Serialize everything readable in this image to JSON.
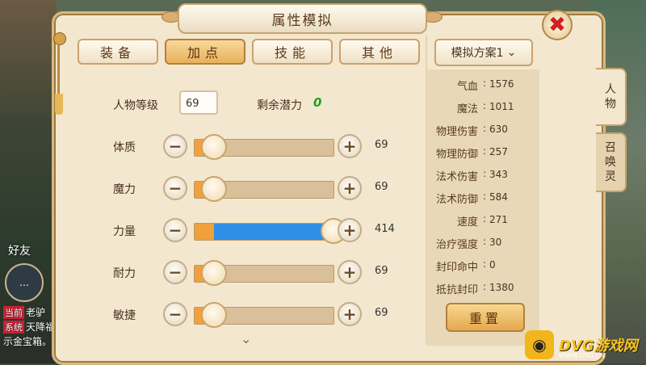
{
  "panel": {
    "title": "属性模拟",
    "close_glyph": "✖"
  },
  "tabs": [
    {
      "label": "装备",
      "active": false
    },
    {
      "label": "加点",
      "active": true
    },
    {
      "label": "技能",
      "active": false
    },
    {
      "label": "其他",
      "active": false
    }
  ],
  "level": {
    "label": "人物等级",
    "value": "69"
  },
  "potential": {
    "label": "剩余潜力",
    "value": "0"
  },
  "attributes": [
    {
      "label": "体质",
      "value": "69",
      "fill_fraction": 0.0
    },
    {
      "label": "魔力",
      "value": "69",
      "fill_fraction": 0.0
    },
    {
      "label": "力量",
      "value": "414",
      "fill_fraction": 1.0
    },
    {
      "label": "耐力",
      "value": "69",
      "fill_fraction": 0.0
    },
    {
      "label": "敏捷",
      "value": "69",
      "fill_fraction": 0.0
    }
  ],
  "controls": {
    "minus_glyph": "−",
    "plus_glyph": "+",
    "scroll_glyph": "⌄"
  },
  "scheme": {
    "label": "模拟方案1",
    "chevron": "⌄"
  },
  "stats": [
    {
      "name": "气血",
      "value": "1576"
    },
    {
      "name": "魔法",
      "value": "1011"
    },
    {
      "name": "物理伤害",
      "value": "630"
    },
    {
      "name": "物理防御",
      "value": "257"
    },
    {
      "name": "法术伤害",
      "value": "343"
    },
    {
      "name": "法术防御",
      "value": "584"
    },
    {
      "name": "速度",
      "value": "271"
    },
    {
      "name": "治疗强度",
      "value": "30"
    },
    {
      "name": "封印命中",
      "value": "0"
    },
    {
      "name": "抵抗封印",
      "value": "1380"
    }
  ],
  "reset_label": "重置",
  "side_tabs": [
    {
      "label": "人物",
      "active": true
    },
    {
      "label": "召唤灵",
      "active": false
    }
  ],
  "background": {
    "friends_label": "好友",
    "chat_lines": [
      {
        "tag": "当前",
        "text": "老驴"
      },
      {
        "tag": "系统",
        "text": "天降福"
      },
      {
        "tag": "",
        "text": "示金宝箱。"
      }
    ]
  },
  "watermark": {
    "text": "DVG游戏网",
    "sub": "WWW.DVG.CN"
  },
  "colors": {
    "panel_bg": "#f3e7cf",
    "accent_gold": "#e8b15c",
    "slider_blue": "#2f8ee6",
    "slider_orange": "#f0a03c",
    "potential_green": "#1ea11e",
    "close_red": "#d02020"
  }
}
